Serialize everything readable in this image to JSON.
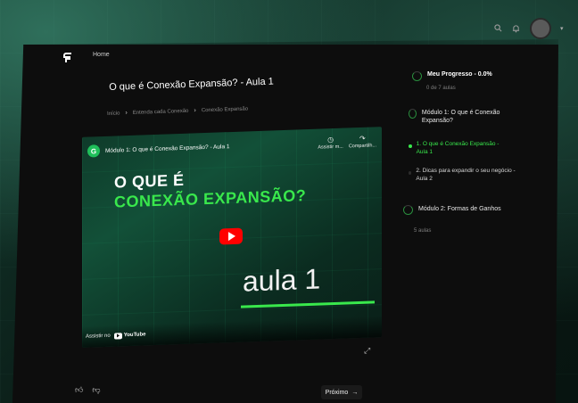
{
  "header": {
    "nav_home": "Home",
    "logo_icon": "brand-logo-icon",
    "icons": [
      "search-icon",
      "bell-icon",
      "avatar",
      "chevron-down-icon"
    ]
  },
  "lesson": {
    "title": "O que é Conexão Expansão? - Aula 1",
    "breadcrumb": [
      "Início",
      "Entenda cada Conexão",
      "Conexão Expansão"
    ]
  },
  "video": {
    "caption": "Módulo 1: O que é Conexão Expansão? - Aula 1",
    "watch_later_label": "Assistir m...",
    "share_label": "Compartilh...",
    "headline_line1": "O QUE É",
    "headline_line2": "CONEXÃO EXPANSÃO?",
    "aula_text": "aula 1",
    "watch_on_label": "Assistir no",
    "youtube_label": "YouTube",
    "accent_color": "#39e84c"
  },
  "footer": {
    "next_label": "Próximo",
    "next_arrow": "→"
  },
  "sidebar": {
    "progress_title": "Meu Progresso - 0.0%",
    "progress_sub": "0 de 7 aulas",
    "progress_fraction": 0.0,
    "module1_title": "Módulo 1: O que é Conexão Expansão?",
    "module1_items": [
      {
        "label": "1. O que é Conexão Expansão - Aula 1",
        "active": true
      },
      {
        "label": "2. Dicas para expandir o seu negócio - Aula 2",
        "active": false
      }
    ],
    "module2_title": "Módulo 2: Formas de Ganhos",
    "module2_sub": "5 aulas"
  }
}
